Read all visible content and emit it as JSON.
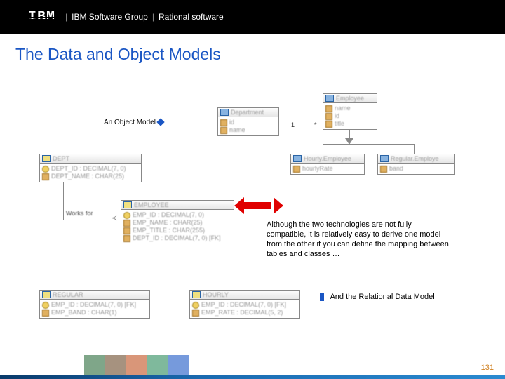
{
  "header": {
    "brand": "IBM",
    "group": "IBM Software Group",
    "product": "Rational software"
  },
  "title": "The Data and Object Models",
  "labels": {
    "object_model": "An Object Model",
    "relational_model": "And the Relational Data Model",
    "works_for": "Works for"
  },
  "note": "Although the two technologies are not fully compatible, it is relatively easy to derive one model from the other if you can define the mapping between tables and classes …",
  "cardinality": {
    "one": "1",
    "many": "*"
  },
  "uml": {
    "department": {
      "name": "Department",
      "attrs": [
        "id",
        "name"
      ]
    },
    "employee": {
      "name": "Employee",
      "attrs": [
        "name",
        "id",
        "title"
      ]
    },
    "hourly_emp": {
      "name": "Hourly.Employee",
      "attrs": [
        "hourlyRate"
      ]
    },
    "regular_emp": {
      "name": "Regular.Employe",
      "attrs": [
        "band"
      ]
    }
  },
  "db": {
    "dept": {
      "name": "DEPT",
      "cols": [
        "DEPT_ID : DECIMAL(7, 0)",
        "DEPT_NAME : CHAR(25)"
      ]
    },
    "employee": {
      "name": "EMPLOYEE",
      "cols": [
        "EMP_ID : DECIMAL(7, 0)",
        "EMP_NAME : CHAR(25)",
        "EMP_TITLE : CHAR(255)",
        "DEPT_ID : DECIMAL(7, 0) [FK]"
      ]
    },
    "regular": {
      "name": "REGULAR",
      "cols": [
        "EMP_ID : DECIMAL(7, 0) [FK]",
        "EMP_BAND : CHAR(1)"
      ]
    },
    "hourly": {
      "name": "HOURLY",
      "cols": [
        "EMP_ID : DECIMAL(7, 0) [FK]",
        "EMP_RATE : DECIMAL(5, 2)"
      ]
    }
  },
  "page_number": "131"
}
